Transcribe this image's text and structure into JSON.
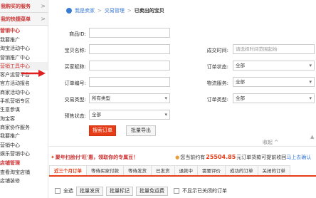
{
  "sidebar": {
    "items": [
      {
        "label": "我购买的服务",
        "type": "head"
      },
      {
        "label": "我的快捷菜单",
        "type": "head"
      },
      {
        "label": "营销中心",
        "type": "section"
      },
      {
        "label": "我要推广",
        "type": "item"
      },
      {
        "label": "淘宝活动中心",
        "type": "item"
      },
      {
        "label": "营销推广中心",
        "type": "item"
      },
      {
        "label": "营销工具中心",
        "type": "item",
        "active": true
      },
      {
        "label": "客户运营平台",
        "type": "item"
      },
      {
        "label": "官方活动报名",
        "type": "item"
      },
      {
        "label": "商家活动中心",
        "type": "item"
      },
      {
        "label": "手机营销专区",
        "type": "item"
      },
      {
        "label": "生意参谋",
        "type": "item"
      },
      {
        "label": "淘宝客",
        "type": "item"
      },
      {
        "label": "商家协作服务",
        "type": "item"
      },
      {
        "label": "我要推广",
        "type": "item"
      },
      {
        "label": "营销中心",
        "type": "item"
      },
      {
        "label": "娱乐营销中心",
        "type": "item"
      },
      {
        "label": "店铺管理",
        "type": "section"
      },
      {
        "label": "查看淘宝店铺",
        "type": "item"
      },
      {
        "label": "店铺装修",
        "type": "item"
      }
    ]
  },
  "breadcrumb": {
    "home": "我是卖家",
    "level1": "交易管理",
    "current": "已卖出的宝贝",
    "sep": ">"
  },
  "form": {
    "product_id_label": "商品ID:",
    "title_label": "宝贝名称:",
    "buyer_label": "买家昵称:",
    "order_no_label": "订单编号:",
    "trade_type_label": "交易类型:",
    "trade_type_value": "所有类型",
    "presale_label": "预售状态:",
    "presale_value": "全部",
    "deal_time_label": "成交时间:",
    "deal_time_placeholder": "请选择时间范围起始",
    "order_status_label": "订单状态:",
    "order_status_value": "全部",
    "logistics_label": "物流服务:",
    "logistics_value": "全部",
    "order_type_label": "订单类型:",
    "order_type_value": "全部",
    "search_button": "搜索订单",
    "export_button": "批量导出",
    "collapse": "收起 ^"
  },
  "notice": {
    "tips_icon": "megaphone-icon",
    "promo": "聚年扫脸付'旺'惠，领取你的专属豆！",
    "currency_icon": "coin-icon",
    "text1": "您当前约有",
    "amount": "25504.85",
    "text2": "元订单货款可提前收回",
    "link": "马上去确认"
  },
  "tabs": [
    "近三个月订单",
    "等待买家付款",
    "等待发货",
    "已发货",
    "退款中",
    "需要评价",
    "成功的订单",
    "关闭的订单"
  ],
  "toolbar": {
    "select_all": "全选",
    "batch_ship": "批量发货",
    "batch_mark": "批量标记",
    "batch_free": "批量免运费",
    "hide_closed": "不显示已关闭的订单"
  },
  "colors": {
    "accent_red": "#e63c17",
    "link_blue": "#3a7bd5"
  }
}
